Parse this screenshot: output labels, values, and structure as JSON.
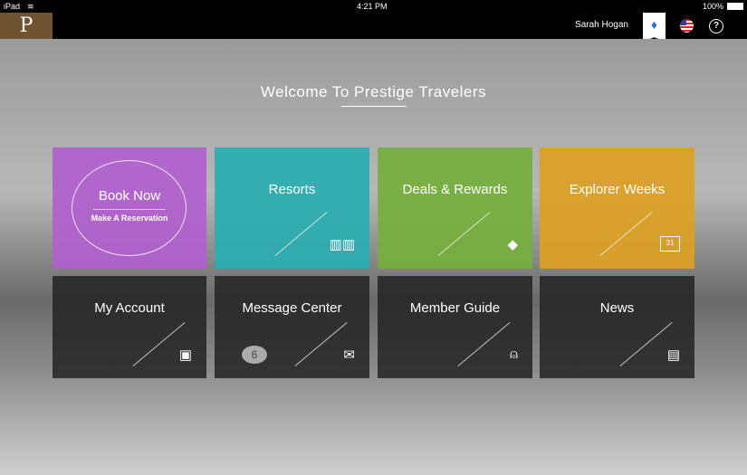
{
  "status": {
    "device": "iPad",
    "time": "4:21 PM",
    "battery": "100%"
  },
  "header": {
    "logo": "P",
    "user": "Sarah Hogan",
    "help": "?"
  },
  "welcome": "Welcome To Prestige Travelers",
  "tiles": [
    {
      "label": "Book Now",
      "sub": "Make A Reservation",
      "color": "#b060cc"
    },
    {
      "label": "Resorts",
      "icon": "buildings-icon",
      "color": "#2aadb0"
    },
    {
      "label": "Deals & Rewards",
      "icon": "diamond-icon",
      "color": "#74ae3c"
    },
    {
      "label": "Explorer Weeks",
      "icon": "calendar-icon",
      "icon_text": "31",
      "color": "#dba021"
    },
    {
      "label": "My Account",
      "icon": "id-card-icon"
    },
    {
      "label": "Message Center",
      "icon": "message-icon",
      "badge": "6"
    },
    {
      "label": "Member Guide",
      "icon": "service-bell-icon"
    },
    {
      "label": "News",
      "icon": "newspaper-icon"
    }
  ]
}
